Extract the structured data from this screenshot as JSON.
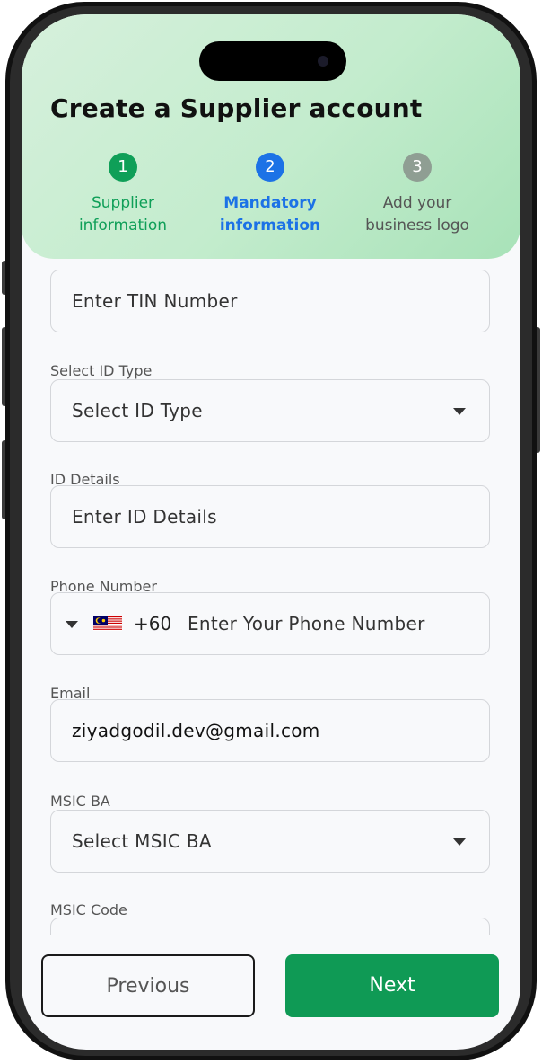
{
  "header": {
    "title": "Create a Supplier account"
  },
  "steps": [
    {
      "number": "1",
      "line1": "Supplier",
      "line2": "information",
      "state": "completed"
    },
    {
      "number": "2",
      "line1": "Mandatory",
      "line2": "information",
      "state": "active"
    },
    {
      "number": "3",
      "line1": "Add your",
      "line2": "business logo",
      "state": "pending"
    }
  ],
  "form": {
    "tin": {
      "placeholder": "Enter TIN Number"
    },
    "id_type": {
      "label": "Select ID Type",
      "placeholder": "Select ID Type"
    },
    "id_details": {
      "label": "ID Details",
      "placeholder": "Enter ID Details"
    },
    "phone": {
      "label": "Phone Number",
      "country_code": "+60",
      "placeholder": "Enter Your Phone Number",
      "flag": "malaysia-flag-icon"
    },
    "email": {
      "label": "Email",
      "value": "ziyadgodil.dev@gmail.com"
    },
    "msic_ba": {
      "label": "MSIC BA",
      "placeholder": "Select MSIC BA"
    },
    "msic_code": {
      "label": "MSIC Code"
    }
  },
  "buttons": {
    "previous": "Previous",
    "next": "Next"
  },
  "colors": {
    "accent_green": "#0f9a55",
    "active_blue": "#1c72e6",
    "pending_gray": "#8f9e93",
    "header_gradient_start": "#d6f0dc",
    "header_gradient_end": "#a8e2b8"
  }
}
